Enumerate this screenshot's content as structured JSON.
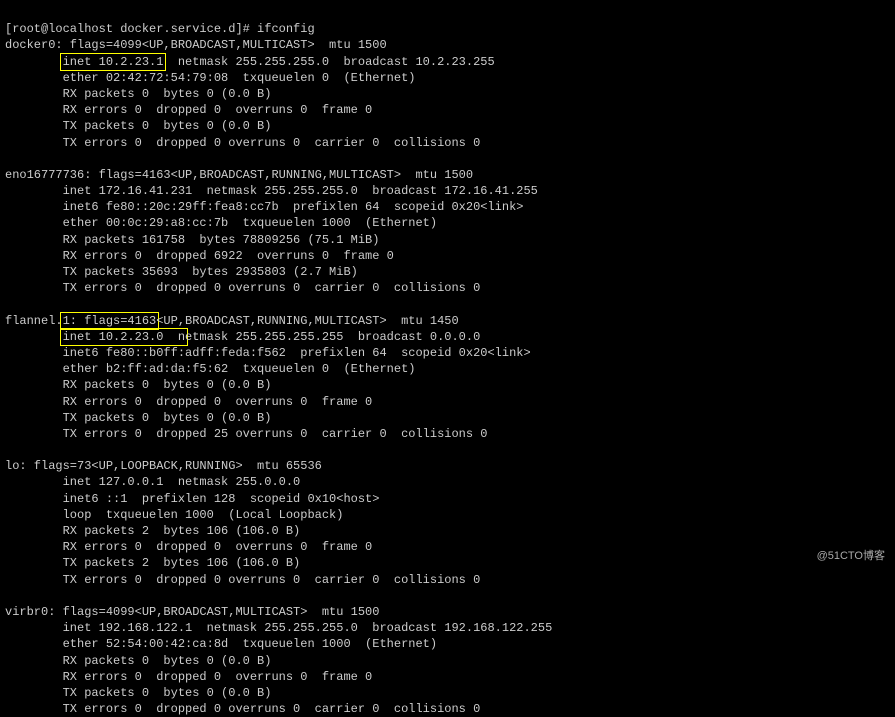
{
  "prompt": "[root@localhost docker.service.d]# ifconfig",
  "interfaces": {
    "docker0": {
      "header": "docker0: flags=4099<UP,BROADCAST,MULTICAST>  mtu 1500",
      "inet_highlighted": "inet 10.2.23.1",
      "inet_rest": "  netmask 255.255.255.0  broadcast 10.2.23.255",
      "ether": "        ether 02:42:72:54:79:08  txqueuelen 0  (Ethernet)",
      "rx_packets": "        RX packets 0  bytes 0 (0.0 B)",
      "rx_errors": "        RX errors 0  dropped 0  overruns 0  frame 0",
      "tx_packets": "        TX packets 0  bytes 0 (0.0 B)",
      "tx_errors": "        TX errors 0  dropped 0 overruns 0  carrier 0  collisions 0"
    },
    "eno16777736": {
      "header": "eno16777736: flags=4163<UP,BROADCAST,RUNNING,MULTICAST>  mtu 1500",
      "inet": "        inet 172.16.41.231  netmask 255.255.255.0  broadcast 172.16.41.255",
      "inet6": "        inet6 fe80::20c:29ff:fea8:cc7b  prefixlen 64  scopeid 0x20<link>",
      "ether": "        ether 00:0c:29:a8:cc:7b  txqueuelen 1000  (Ethernet)",
      "rx_packets": "        RX packets 161758  bytes 78809256 (75.1 MiB)",
      "rx_errors": "        RX errors 0  dropped 6922  overruns 0  frame 0",
      "tx_packets": "        TX packets 35693  bytes 2935803 (2.7 MiB)",
      "tx_errors": "        TX errors 0  dropped 0 overruns 0  carrier 0  collisions 0"
    },
    "flannel": {
      "header_prefix": "flannel.",
      "header_suffix": "<UP,BROADCAST,RUNNING,MULTICAST>  mtu 1450",
      "inet_highlighted": "inet 10.2.23.0  n",
      "hidden_middle": "1: flags=4163",
      "inet_rest": "etmask 255.255.255.255  broadcast 0.0.0.0",
      "inet6": "        inet6 fe80::b0ff:adff:feda:f562  prefixlen 64  scopeid 0x20<link>",
      "ether": "        ether b2:ff:ad:da:f5:62  txqueuelen 0  (Ethernet)",
      "rx_packets": "        RX packets 0  bytes 0 (0.0 B)",
      "rx_errors": "        RX errors 0  dropped 0  overruns 0  frame 0",
      "tx_packets": "        TX packets 0  bytes 0 (0.0 B)",
      "tx_errors": "        TX errors 0  dropped 25 overruns 0  carrier 0  collisions 0"
    },
    "lo": {
      "header": "lo: flags=73<UP,LOOPBACK,RUNNING>  mtu 65536",
      "inet": "        inet 127.0.0.1  netmask 255.0.0.0",
      "inet6": "        inet6 ::1  prefixlen 128  scopeid 0x10<host>",
      "loop": "        loop  txqueuelen 1000  (Local Loopback)",
      "rx_packets": "        RX packets 2  bytes 106 (106.0 B)",
      "rx_errors": "        RX errors 0  dropped 0  overruns 0  frame 0",
      "tx_packets": "        TX packets 2  bytes 106 (106.0 B)",
      "tx_errors": "        TX errors 0  dropped 0 overruns 0  carrier 0  collisions 0"
    },
    "virbr0": {
      "header": "virbr0: flags=4099<UP,BROADCAST,MULTICAST>  mtu 1500",
      "inet": "        inet 192.168.122.1  netmask 255.255.255.0  broadcast 192.168.122.255",
      "ether": "        ether 52:54:00:42:ca:8d  txqueuelen 1000  (Ethernet)",
      "rx_packets": "        RX packets 0  bytes 0 (0.0 B)",
      "rx_errors": "        RX errors 0  dropped 0  overruns 0  frame 0",
      "tx_packets": "        TX packets 0  bytes 0 (0.0 B)",
      "tx_errors": "        TX errors 0  dropped 0 overruns 0  carrier 0  collisions 0"
    }
  },
  "watermark": "@51CTO博客"
}
